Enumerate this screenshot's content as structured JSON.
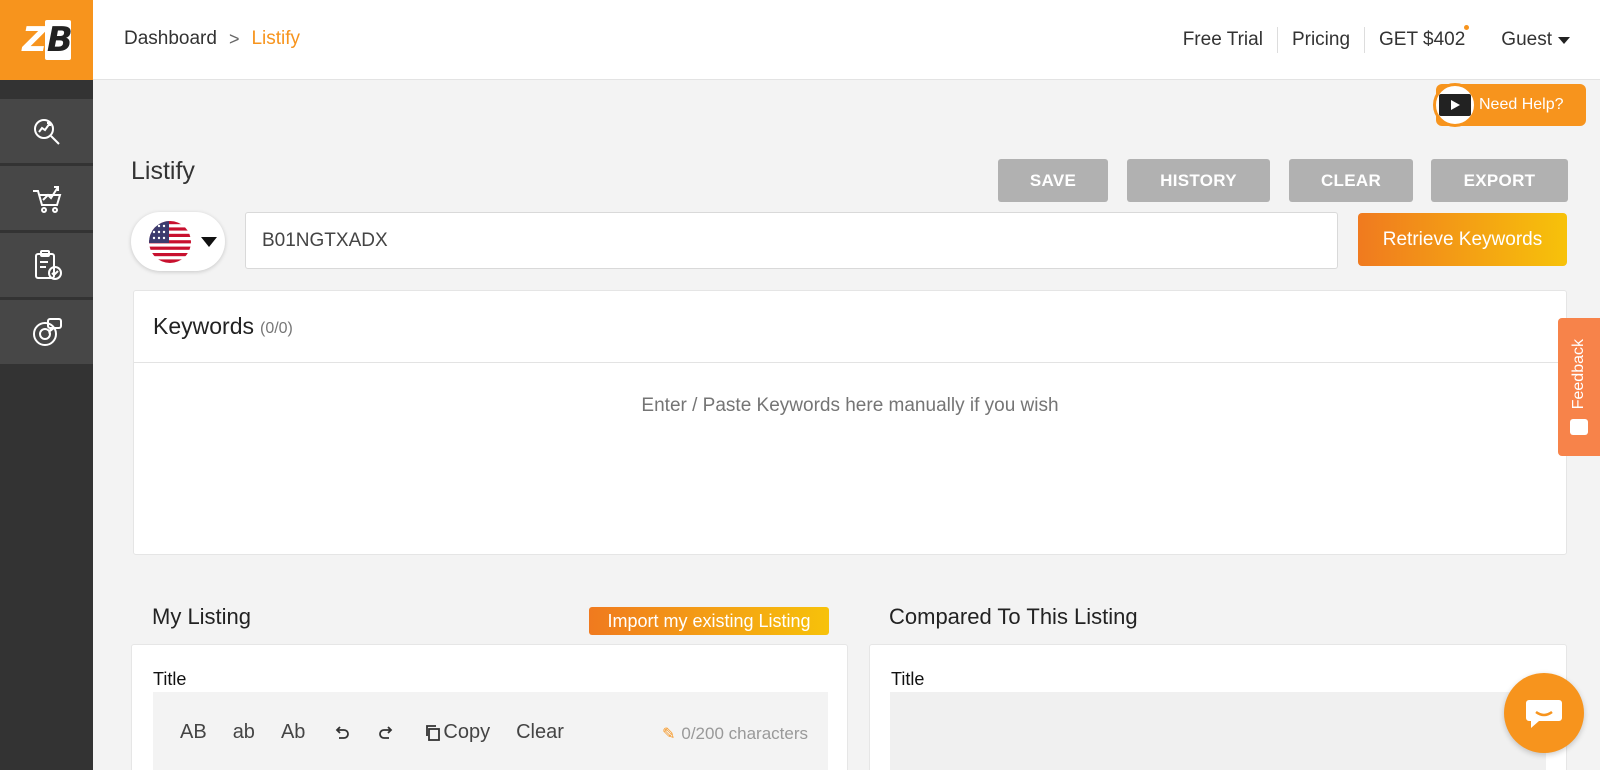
{
  "logo": {
    "text_z": "Z",
    "text_b": "B"
  },
  "sidebar": {
    "items": [
      {
        "icon": "analytics-search-icon"
      },
      {
        "icon": "cart-chart-icon"
      },
      {
        "icon": "clipboard-check-icon"
      },
      {
        "icon": "target-chat-icon"
      }
    ]
  },
  "breadcrumb": {
    "home": "Dashboard",
    "separator": ">",
    "current": "Listify"
  },
  "topnav": {
    "free_trial": "Free Trial",
    "pricing": "Pricing",
    "get_offer": "GET $402",
    "guest": "Guest"
  },
  "help": {
    "label": "Need Help?"
  },
  "page": {
    "title": "Listify"
  },
  "actions": {
    "save": "SAVE",
    "history": "HISTORY",
    "clear": "CLEAR",
    "export": "EXPORT"
  },
  "search": {
    "asin_value": "B01NGTXADX",
    "retrieve_label": "Retrieve Keywords",
    "country": "US"
  },
  "keywords": {
    "title": "Keywords",
    "count": "(0/0)",
    "placeholder": "Enter / Paste Keywords here manually if you wish"
  },
  "feedback": {
    "label": "Feedback"
  },
  "my_listing": {
    "title": "My Listing",
    "import_label": "Import my existing Listing",
    "field_label": "Title",
    "toolbar": {
      "upper": "AB",
      "lower": "ab",
      "capitalize": "Ab",
      "copy": "Copy",
      "clear": "Clear"
    },
    "char_count": "0/200 characters"
  },
  "compared": {
    "title": "Compared To This Listing",
    "field_label": "Title"
  },
  "colors": {
    "accent": "#f7941d",
    "sidebar": "#333333",
    "button_gray": "#b1b1b1"
  }
}
